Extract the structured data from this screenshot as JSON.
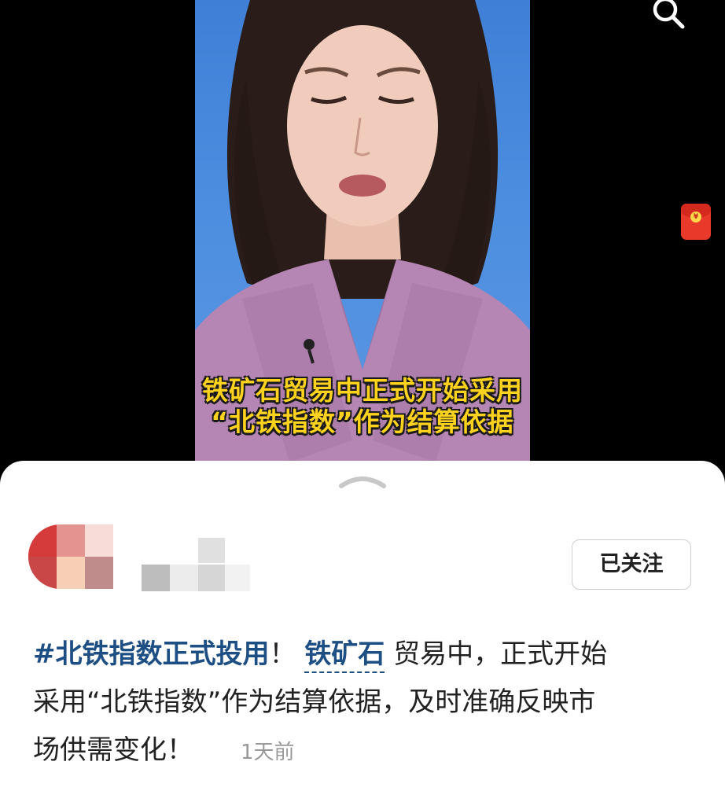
{
  "video": {
    "caption_line1": "铁矿石贸易中正式开始采用",
    "caption_line2": "“北铁指数”作为结算依据"
  },
  "header": {
    "search_icon": "search-icon",
    "red_packet_icon": "red-packet-icon",
    "red_packet_glyph": "¥"
  },
  "sheet": {
    "expand_icon": "chevron-up-icon"
  },
  "author": {
    "follow_label": "已关注"
  },
  "post": {
    "hashtag": "#北铁指数正式投用",
    "exclaim1": "！",
    "topic_link": "铁矿石",
    "line1_rest": "贸易中，正式开始",
    "line2": "采用“北铁指数”作为结算依据，及时准确反映市",
    "line3": "场供需变化！",
    "time": "1天前"
  },
  "colors": {
    "link": "#1e4f84",
    "caption": "#ffd21e",
    "video_bg": "#4d8ee0"
  }
}
